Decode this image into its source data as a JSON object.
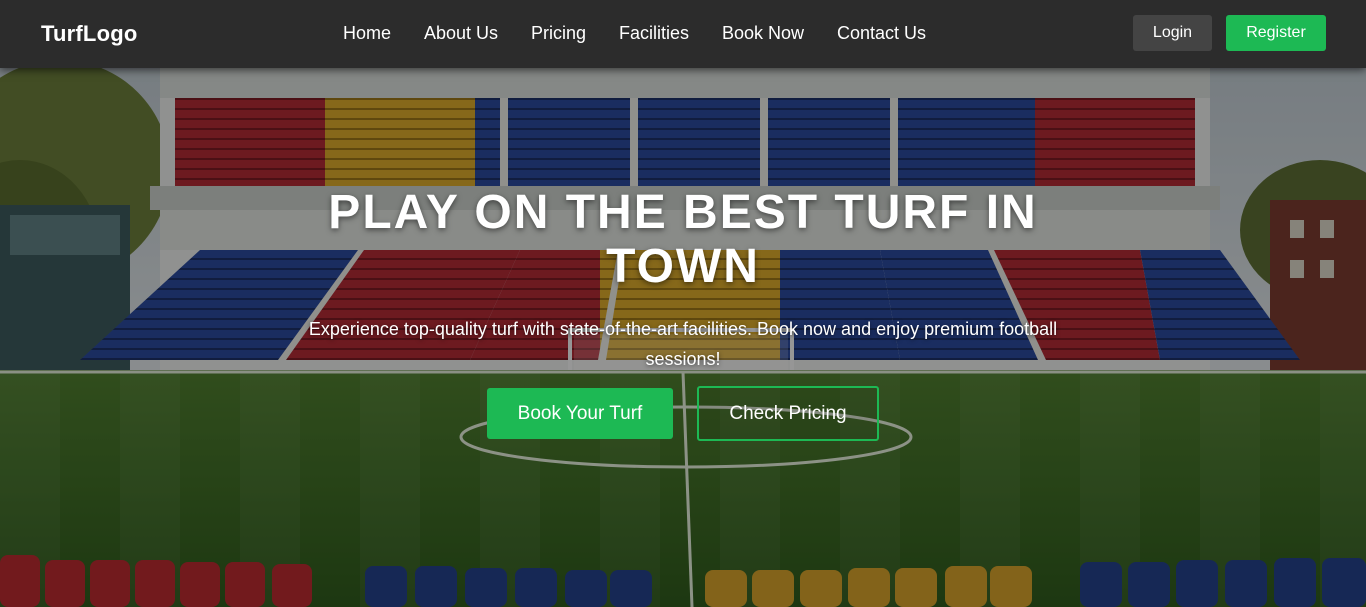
{
  "navbar": {
    "logo": "TurfLogo",
    "links": [
      {
        "label": "Home"
      },
      {
        "label": "About Us"
      },
      {
        "label": "Pricing"
      },
      {
        "label": "Facilities"
      },
      {
        "label": "Book Now"
      },
      {
        "label": "Contact Us"
      }
    ],
    "login_label": "Login",
    "register_label": "Register"
  },
  "hero": {
    "title": "PLAY ON THE BEST TURF IN TOWN",
    "subtitle": "Experience top-quality turf with state-of-the-art facilities. Book now and enjoy premium football sessions!",
    "primary_button": "Book Your Turf",
    "secondary_button": "Check Pricing",
    "background": "football-stadium-photo"
  },
  "colors": {
    "accent": "#1db954",
    "navbar_bg": "#2c2c2c",
    "login_bg": "#444444",
    "text": "#ffffff"
  }
}
